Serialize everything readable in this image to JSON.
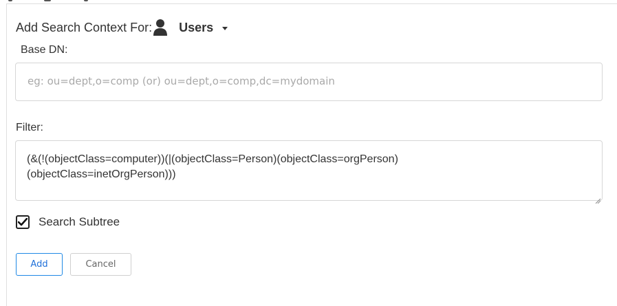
{
  "header": {
    "label": "Add Search Context For:",
    "context_icon": "user-icon",
    "context_value": "Users"
  },
  "base_dn": {
    "label": "Base DN:",
    "value": "",
    "placeholder": "eg: ou=dept,o=comp (or) ou=dept,o=comp,dc=mydomain"
  },
  "filter": {
    "label": "Filter:",
    "value": "(&(!(objectClass=computer))(|(objectClass=Person)(objectClass=orgPerson)(objectClass=inetOrgPerson)))"
  },
  "search_subtree": {
    "label": "Search Subtree",
    "checked": true
  },
  "actions": {
    "add_label": "Add",
    "cancel_label": "Cancel"
  },
  "colors": {
    "accent": "#1e88e5",
    "border": "#d6d6d6",
    "text": "#333333",
    "placeholder": "#a9a9a9"
  }
}
